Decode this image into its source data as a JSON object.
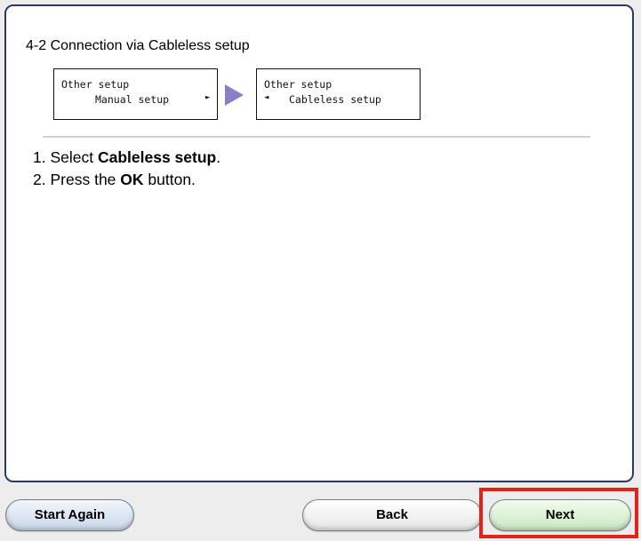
{
  "page": {
    "title": "4-2 Connection via Cableless setup"
  },
  "lcd_screens": [
    {
      "line1": "Other setup",
      "line2": "Manual setup",
      "arrow": "►"
    },
    {
      "line1": "Other setup",
      "line2": "Cableless setup",
      "arrow": "◄"
    }
  ],
  "steps": [
    {
      "num": "1.",
      "pre": "Select ",
      "bold": "Cableless setup",
      "post": "."
    },
    {
      "num": "2.",
      "pre": "Press the ",
      "bold": "OK",
      "post": " button."
    }
  ],
  "buttons": {
    "start_again": "Start Again",
    "back": "Back",
    "next": "Next"
  },
  "colors": {
    "panel_border": "#2c3a63",
    "flow_arrow": "#8a7fc7",
    "highlight": "#e2231a",
    "next_button": "#cbe8c3",
    "start_button": "#c9d8ea"
  },
  "icons": {
    "flow_arrow": "right-triangle-arrow",
    "lcd_right": "small-right-arrow",
    "lcd_left": "small-left-arrow"
  }
}
